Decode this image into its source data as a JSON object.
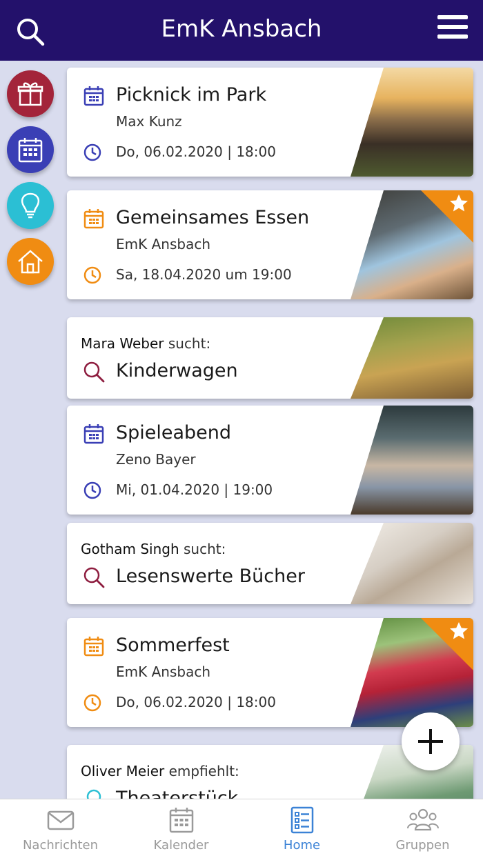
{
  "header": {
    "title": "EmK Ansbach",
    "search_icon": "search-icon",
    "menu_icon": "hamburger-menu-icon"
  },
  "side_actions": [
    {
      "name": "gift-icon",
      "color": "#a3243a"
    },
    {
      "name": "calendar-icon",
      "color": "#3a3fb5"
    },
    {
      "name": "lightbulb-icon",
      "color": "#2bbfd4"
    },
    {
      "name": "home-icon",
      "color": "#f08c12"
    }
  ],
  "feed": {
    "event1": {
      "title": "Picknick im Park",
      "organizer": "Max Kunz",
      "date": "Do, 06.02.2020 | 18:00"
    },
    "event2": {
      "title": "Gemeinsames Essen",
      "organizer": "EmK Ansbach",
      "date": "Sa, 18.04.2020 um 19:00",
      "featured": true
    },
    "search1": {
      "user": "Mara Weber",
      "verb": "sucht:",
      "item": "Kinderwagen"
    },
    "event3": {
      "title": "Spieleabend",
      "organizer": "Zeno Bayer",
      "date": "Mi, 01.04.2020 | 19:00"
    },
    "search2": {
      "user": "Gotham Singh",
      "verb": "sucht:",
      "item": "Lesenswerte Bücher"
    },
    "event4": {
      "title": "Sommerfest",
      "organizer": "EmK Ansbach",
      "date": "Do, 06.02.2020 | 18:00",
      "featured": true
    },
    "recommend1": {
      "user": "Oliver Meier",
      "verb": "empfiehlt:",
      "item": "Theaterstück"
    }
  },
  "fab": {
    "icon": "plus-icon"
  },
  "tabs": [
    {
      "label": "Nachrichten",
      "icon": "envelope-icon",
      "active": false
    },
    {
      "label": "Kalender",
      "icon": "calendar-icon",
      "active": false
    },
    {
      "label": "Home",
      "icon": "list-icon",
      "active": true
    },
    {
      "label": "Gruppen",
      "icon": "group-icon",
      "active": false
    }
  ],
  "colors": {
    "header_bg": "#23116b",
    "accent_blue": "#3a3fb5",
    "accent_orange": "#f08c12",
    "search_red": "#8e1d3f",
    "active_tab": "#3b82d6"
  }
}
